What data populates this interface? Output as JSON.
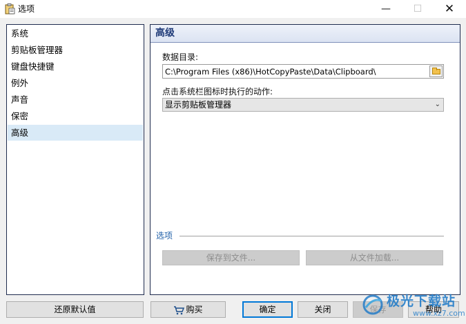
{
  "window": {
    "title": "选项",
    "min_symbol": "—",
    "max_symbol": "☐",
    "close_symbol": "✕"
  },
  "sidebar": {
    "items": [
      {
        "label": "系统"
      },
      {
        "label": "剪贴板管理器"
      },
      {
        "label": "键盘快捷键"
      },
      {
        "label": "例外"
      },
      {
        "label": "声音"
      },
      {
        "label": "保密"
      },
      {
        "label": "高级"
      }
    ],
    "selected_index": 6,
    "selected_color": "#d9eaf7"
  },
  "panel": {
    "title": "高级",
    "data_dir_label": "数据目录:",
    "data_dir_value": "C:\\Program Files (x86)\\HotCopyPaste\\Data\\Clipboard\\",
    "tray_action_label": "点击系统栏图标时执行的动作:",
    "tray_action_value": "显示剪贴板管理器",
    "options_group_label": "选项",
    "save_to_file_label": "保存到文件...",
    "load_from_file_label": "从文件加载..."
  },
  "footer": {
    "restore_defaults_label": "还原默认值",
    "buy_label": "购买",
    "ok_label": "确定",
    "close_label": "关闭",
    "save_label": "保存",
    "help_label": "帮助"
  },
  "watermark": {
    "text": "极光下载站",
    "sub": "www.xz7.com"
  },
  "colors": {
    "accent_header_text": "#1f3a78",
    "group_label": "#1f5fa8",
    "default_button_border": "#0078d7"
  }
}
